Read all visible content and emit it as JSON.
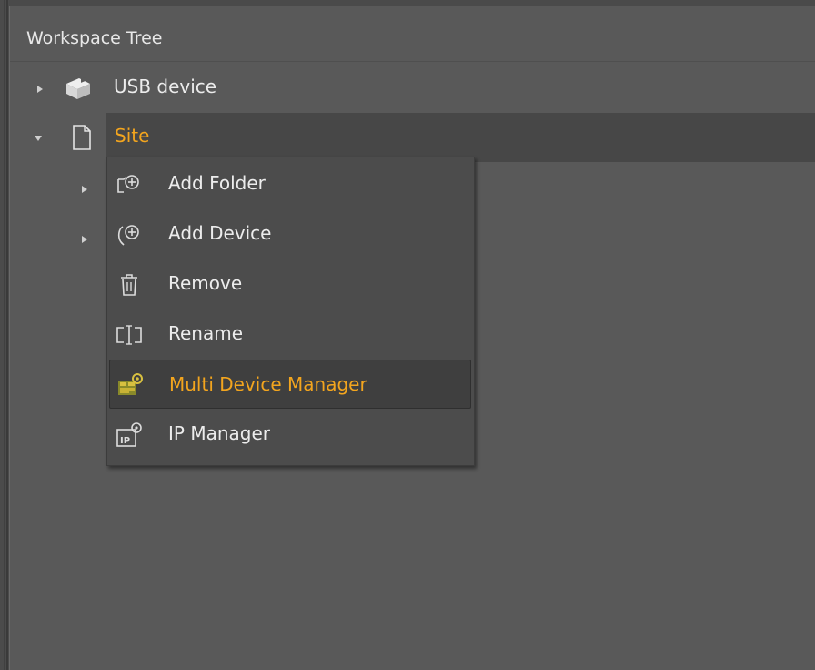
{
  "panel": {
    "title": "Workspace Tree"
  },
  "tree": {
    "items": [
      {
        "label": "USB device",
        "icon": "usb-device-icon",
        "expanded": false
      },
      {
        "label": "Site",
        "icon": "document-icon",
        "expanded": true,
        "selected": true
      }
    ]
  },
  "context_menu": {
    "items": [
      {
        "label": "Add Folder",
        "icon": "add-folder-icon"
      },
      {
        "label": "Add Device",
        "icon": "add-device-icon"
      },
      {
        "label": "Remove",
        "icon": "trash-icon"
      },
      {
        "label": "Rename",
        "icon": "rename-icon"
      },
      {
        "label": "Multi Device Manager",
        "icon": "multi-device-manager-icon",
        "highlighted": true
      },
      {
        "label": "IP Manager",
        "icon": "ip-manager-icon"
      }
    ]
  },
  "colors": {
    "background": "#595959",
    "accent": "#f3a51e",
    "menu_bg": "#4c4c4c"
  }
}
